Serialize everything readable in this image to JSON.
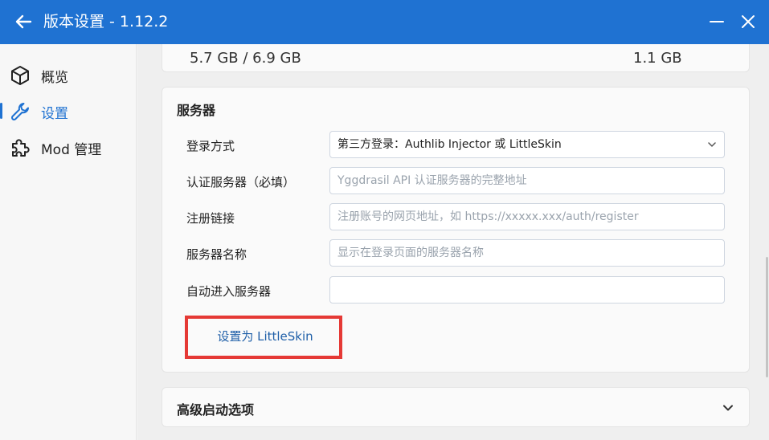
{
  "window": {
    "title": "版本设置 - 1.12.2"
  },
  "sidebar": {
    "items": [
      {
        "label": "概览",
        "icon": "cube-icon"
      },
      {
        "label": "设置",
        "icon": "wrench-icon"
      },
      {
        "label": "Mod 管理",
        "icon": "puzzle-icon"
      }
    ]
  },
  "memory": {
    "used": "5.7 GB / 6.9 GB",
    "allocated": "1.1 GB"
  },
  "server": {
    "section_title": "服务器",
    "login_method_label": "登录方式",
    "login_method_value": "第三方登录：Authlib Injector 或 LittleSkin",
    "auth_server_label": "认证服务器（必填）",
    "auth_server_placeholder": "Yggdrasil API 认证服务器的完整地址",
    "register_link_label": "注册链接",
    "register_link_placeholder": "注册账号的网页地址，如 https://xxxxx.xxx/auth/register",
    "server_name_label": "服务器名称",
    "server_name_placeholder": "显示在登录页面的服务器名称",
    "auto_join_label": "自动进入服务器",
    "auto_join_value": "",
    "set_littleskin_button": "设置为 LittleSkin"
  },
  "advanced": {
    "title": "高级启动选项"
  },
  "colors": {
    "accent": "#1f72d2",
    "highlight": "#e53935"
  }
}
